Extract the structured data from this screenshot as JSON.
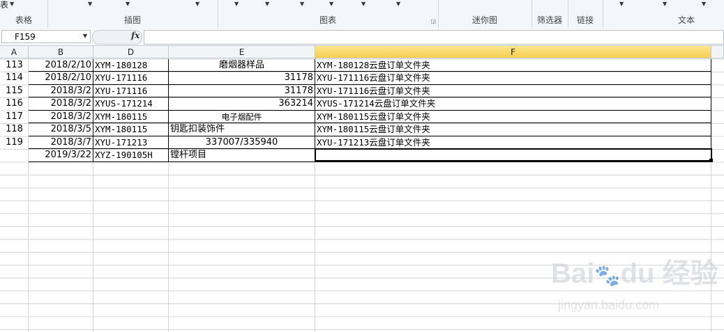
{
  "ribbon": {
    "top_left_label": "表",
    "groups": [
      {
        "label": "表格"
      },
      {
        "label": "插图"
      },
      {
        "label": "图表"
      },
      {
        "label": "迷你图"
      },
      {
        "label": "筛选器"
      },
      {
        "label": "链接"
      },
      {
        "label": "文本"
      }
    ]
  },
  "formula_bar": {
    "name_box": "F159",
    "fx_label": "fx",
    "formula": ""
  },
  "columns": [
    {
      "label": "A"
    },
    {
      "label": "B"
    },
    {
      "label": "D"
    },
    {
      "label": "E"
    },
    {
      "label": "F",
      "selected": true
    }
  ],
  "rows": [
    {
      "a": "113",
      "b": "2018/2/10",
      "d": "XYM-180128",
      "e": "磨烟器样品",
      "f": "XYM-180128云盘订单文件夹"
    },
    {
      "a": "114",
      "b": "2018/2/10",
      "d": "XYU-171116",
      "e": "31178",
      "f": "XYU-171116云盘订单文件夹"
    },
    {
      "a": "115",
      "b": "2018/3/2",
      "d": "XYU-171116",
      "e": "31178",
      "f": "XYU-171116云盘订单文件夹"
    },
    {
      "a": "116",
      "b": "2018/3/2",
      "d": "XYUS-171214",
      "e": "363214",
      "f": "XYUS-171214云盘订单文件夹"
    },
    {
      "a": "117",
      "b": "2018/3/2",
      "d": "XYM-180115",
      "e": "电子烟配件",
      "f": "XYM-180115云盘订单文件夹"
    },
    {
      "a": "118",
      "b": "2018/3/5",
      "d": "XYM-180115",
      "e": "钥匙扣装饰件",
      "f": "XYM-180115云盘订单文件夹"
    },
    {
      "a": "119",
      "b": "2018/3/7",
      "d": "XYU-171213",
      "e": "337007/335940",
      "f": "XYU-171213云盘订单文件夹"
    },
    {
      "a": "",
      "b": "2019/3/22",
      "d": "XYZ-190105H",
      "e": "镗杆项目",
      "f": ""
    }
  ],
  "watermark": {
    "logo": "Bai du 经验",
    "url": "jingyan.baidu.com"
  }
}
